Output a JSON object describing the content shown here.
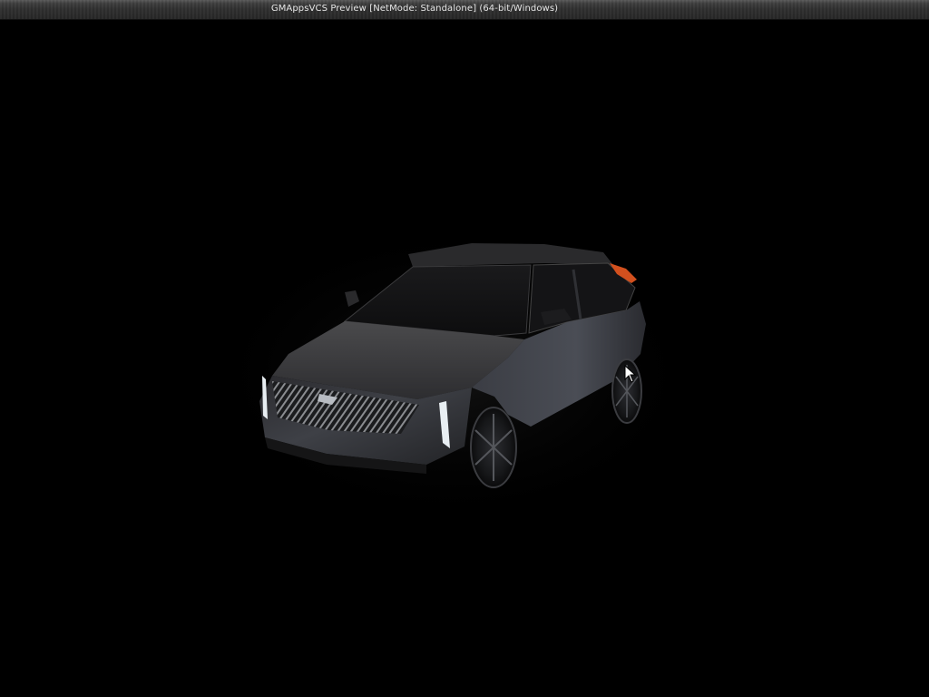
{
  "window": {
    "title": "GMAppsVCS Preview [NetMode: Standalone] (64-bit/Windows)"
  },
  "viewport": {
    "background_color": "#000000",
    "subject": "vehicle-3d-model",
    "cursor": "arrow-cursor-icon"
  },
  "colors": {
    "body_paint": "#3a3c42",
    "headlight": "#e8eef2",
    "tail_light": "#d2501e"
  }
}
